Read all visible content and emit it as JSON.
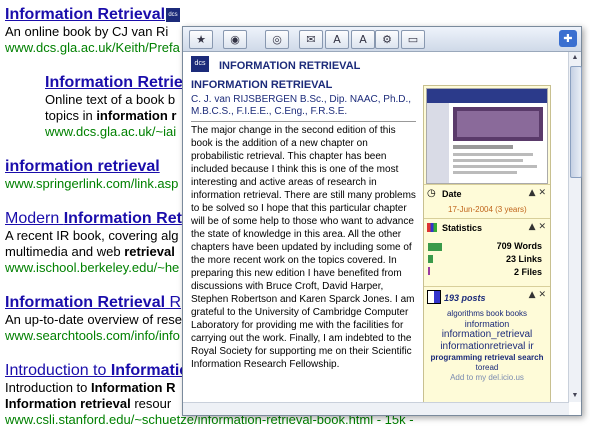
{
  "results": [
    {
      "title_plain": "",
      "title_bold": "Information Retrieval",
      "snippet": "An online book by CJ van Ri",
      "url": "www.dcs.gla.ac.uk/Keith/Prefa"
    },
    {
      "title_plain": "",
      "title_bold": "Information Retrie",
      "snippet": "Online text of a book b",
      "snippet2_prefix": "topics in ",
      "snippet2_bold": "information r",
      "url": "www.dcs.gla.ac.uk/~iai"
    },
    {
      "title_plain": "",
      "title_bold": "information retrieval",
      "url": "www.springerlink.com/link.asp"
    },
    {
      "title_plain": "Modern ",
      "title_bold": "Information Ret",
      "snippet": "A recent IR book, covering alg",
      "snippet2_prefix": "multimedia and web ",
      "snippet2_bold": "retrieval",
      "url": "www.ischool.berkeley.edu/~he"
    },
    {
      "title_plain": "",
      "title_bold": "Information Retrieval",
      "title_suffix": " R",
      "snippet": "An up-to-date overview of rese",
      "url": "www.searchtools.com/info/info"
    },
    {
      "title_plain": "Introduction to ",
      "title_bold": "Informatio",
      "snippet_prefix": "Introduction to ",
      "snippet_bold": "Information R",
      "snippet2_bold": "Information retrieval",
      "snippet2_suffix": " resour",
      "url": "www.csli.stanford.edu/~schuetze/information-retrieval-book.html - 15k -"
    }
  ],
  "popup": {
    "header_logo": "dcs",
    "header_title": "INFORMATION RETRIEVAL",
    "book_title": "INFORMATION RETRIEVAL",
    "authors": "C. J. van RIJSBERGEN B.Sc., Dip. NAAC, Ph.D., M.B.C.S., F.I.E.E., C.Eng., F.R.S.E.",
    "description": "The major change in the second edition of this book is the addition of a new chapter on probabilistic retrieval. This chapter has been included because I think this is one of the most interesting and active areas of research in information retrieval. There are still many problems to be solved so I hope that this particular chapter will be of some help to those who want to advance the state of knowledge in this area. All the other chapters have been updated by including some of the more recent work on the topics covered. In preparing this new edition I have benefited from discussions with Bruce Croft, David Harper, Stephen Robertson and Karen Sparck Jones. I am grateful to the University of Cambridge Computer Laboratory for providing me with the facilities for carrying out the work. Finally, I am indebted to the Royal Society for supporting me on their Scientific Information Research Fellowship.",
    "date_label": "Date",
    "date_value": "17-Jun-2004 (3 years)",
    "stats_label": "Statistics",
    "stats": {
      "words": "709 Words",
      "links": "23 Links",
      "files": "2 Files"
    },
    "posts_count": "193 posts",
    "tags": [
      "algorithms book books",
      "information",
      "information_retrieval",
      "informationretrieval ir",
      "programming retrieval search",
      "toread"
    ],
    "add_link": "Add to my del.icio.us"
  },
  "colors": {
    "link": "#1a0dab",
    "url": "#008000",
    "navy": "#1c2b7a"
  },
  "icons": [
    "star-icon",
    "globe-search-icon",
    "globe-icon",
    "mail-icon",
    "font-icon",
    "translate-icon",
    "gear-icon",
    "chat-icon",
    "puzzle-icon"
  ]
}
